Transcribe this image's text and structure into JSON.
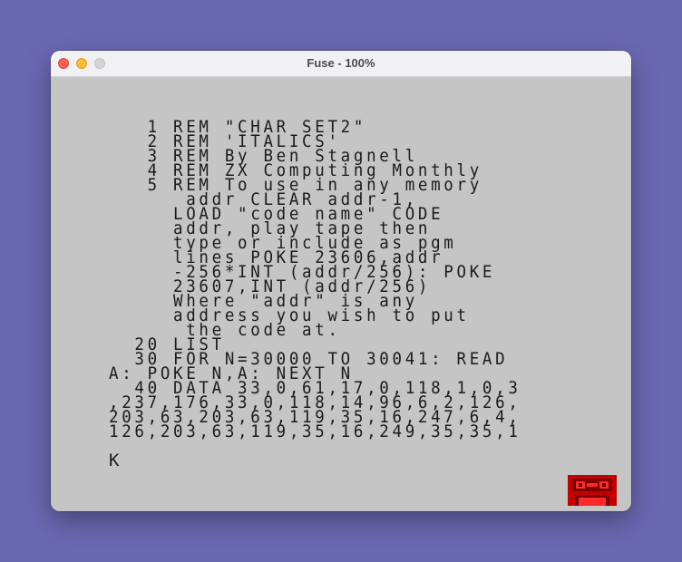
{
  "window": {
    "title": "Fuse - 100%"
  },
  "screen": {
    "listing": [
      "   1 REM \"CHAR SET2\"",
      "   2 REM 'ITALICS'",
      "   3 REM By Ben Stagnell",
      "   4 REM ZX Computing Monthly",
      "   5 REM To use in any memory",
      "      addr CLEAR addr-1,",
      "     LOAD \"code name\" CODE",
      "     addr, play tape then",
      "     type or include as pgm",
      "     lines POKE 23606,addr",
      "     -256*INT (addr/256): POKE",
      "     23607,INT (addr/256)",
      "     Where \"addr\" is any",
      "     address you wish to put",
      "      the code at.",
      "  20 LIST",
      "  30 FOR N=30000 TO 30041: READ",
      "A: POKE N,A: NEXT N",
      "  40 DATA 33,0,61,17,0,118,1,0,3",
      ",237,176,33,0,118,14,96,6,2,126,",
      "203,63,203,63,119,35,16,247,6,4,",
      "126,203,63,119,35,16,249,35,35,1"
    ],
    "cursor": "K"
  },
  "tape_icon": {
    "icon": "cassette-tape-icon",
    "color": "#cc0000"
  }
}
